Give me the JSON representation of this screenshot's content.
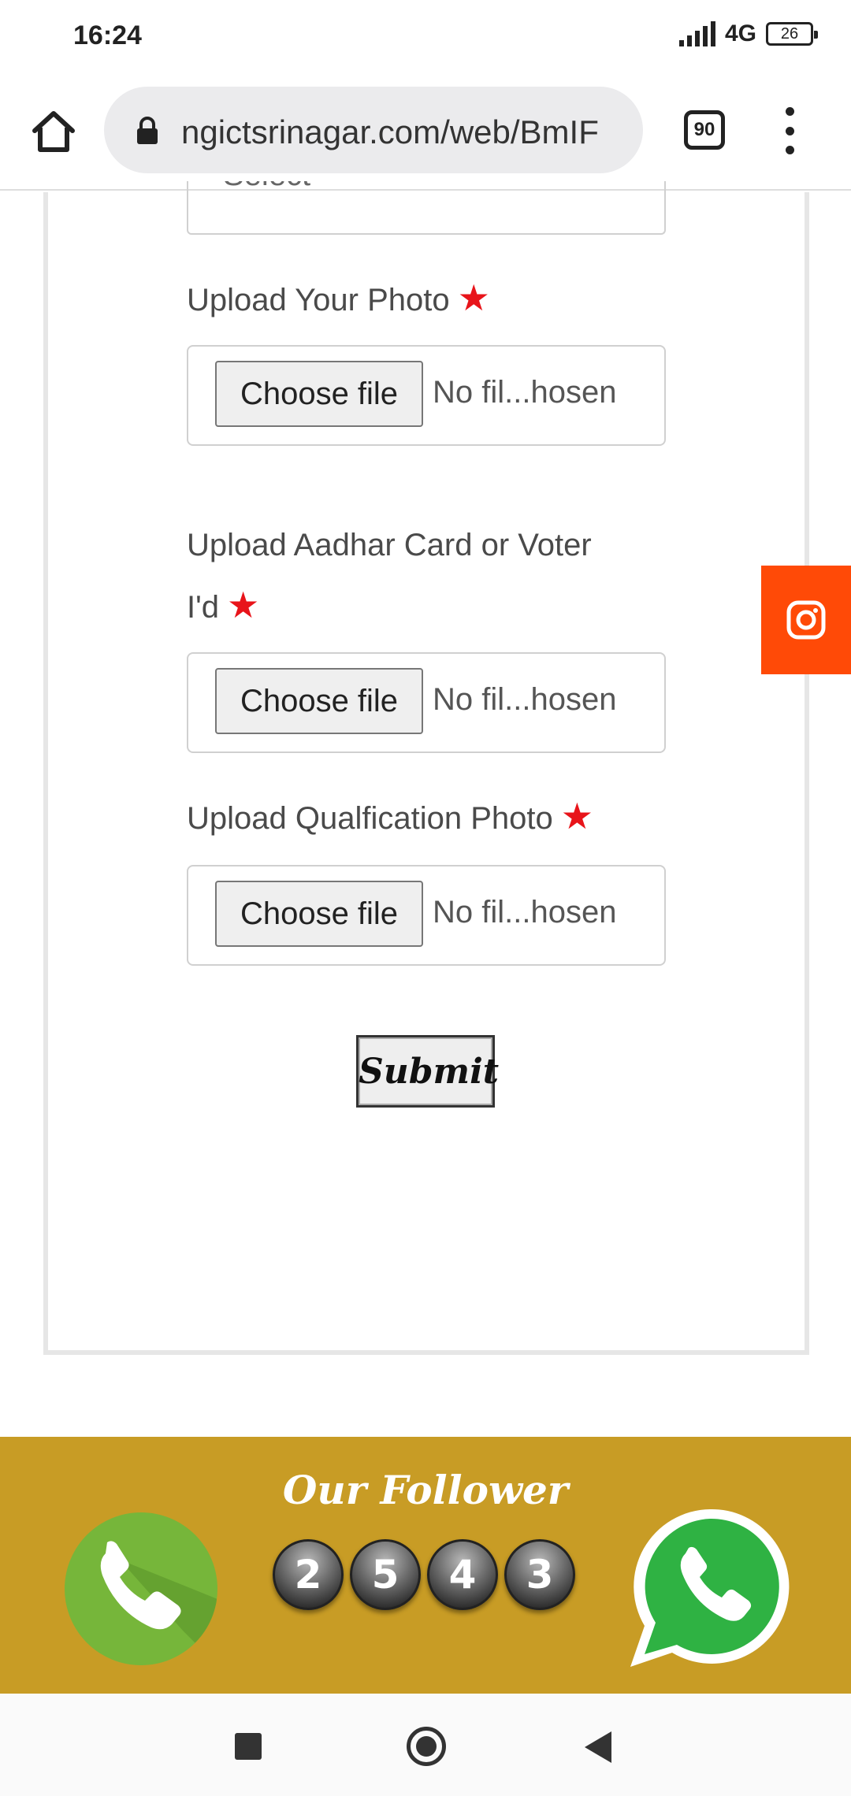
{
  "status_bar": {
    "time": "16:24",
    "network": "4G",
    "battery": "26"
  },
  "browser": {
    "url": "ngictsrinagar.com/web/BmIF",
    "tab_count": "90"
  },
  "form": {
    "select_placeholder": "Select",
    "fields": [
      {
        "label": "Upload Your Photo",
        "required": true,
        "button": "Choose file",
        "status": "No fil...hosen"
      },
      {
        "label_line1": "Upload Aadhar Card or Voter",
        "label_line2": "I'd",
        "required": true,
        "button": "Choose file",
        "status": "No fil...hosen"
      },
      {
        "label": "Upload Qualfication Photo",
        "required": true,
        "button": "Choose file",
        "status": "No fil...hosen"
      }
    ],
    "submit_label": "Submit"
  },
  "social": {
    "instagram_icon": "instagram-icon",
    "accent_color": "#ff4a07"
  },
  "follower": {
    "title": "Our Follower",
    "digits": [
      "2",
      "5",
      "4",
      "3"
    ],
    "band_color": "#c89c25"
  }
}
